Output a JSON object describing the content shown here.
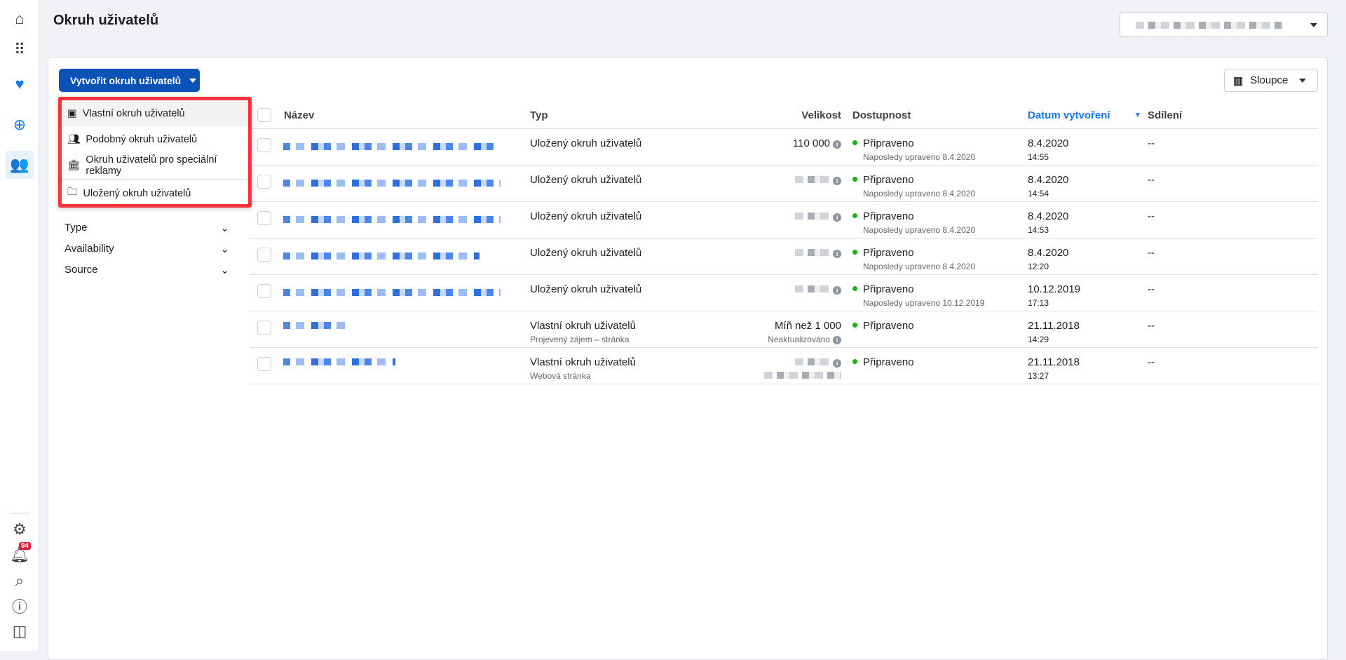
{
  "page": {
    "title": "Okruh uživatelů"
  },
  "nav": {
    "notifications_count": "94"
  },
  "toolbar": {
    "create_label": "Vytvořit okruh uživatelů",
    "columns_label": "Sloupce"
  },
  "create_menu": [
    {
      "label": "Vlastní okruh uživatelů",
      "icon": "custom-audience-icon"
    },
    {
      "label": "Podobný okruh uživatelů",
      "icon": "lookalike-icon"
    },
    {
      "label": "Okruh uživatelů pro speciální reklamy",
      "icon": "bank-icon"
    },
    {
      "label": "Uložený okruh uživatelů",
      "icon": "folder-icon"
    }
  ],
  "filters": [
    {
      "label": "Type"
    },
    {
      "label": "Availability"
    },
    {
      "label": "Source"
    }
  ],
  "table": {
    "headers": {
      "name": "Název",
      "type": "Typ",
      "size": "Velikost",
      "availability": "Dostupnost",
      "created": "Datum vytvoření",
      "sharing": "Sdílení"
    },
    "sort_color": "#1877f2",
    "rows": [
      {
        "type": "Uložený okruh uživatelů",
        "type_sub": "",
        "size": "110 000",
        "size_sub": "",
        "status": "Připraveno",
        "status_sub": "Naposledy upraveno 8.4.2020",
        "date": "8.4.2020",
        "time": "14:55",
        "sharing": "--"
      },
      {
        "type": "Uložený okruh uživatelů",
        "type_sub": "",
        "size": "",
        "size_sub": "",
        "status": "Připraveno",
        "status_sub": "Naposledy upraveno 8.4.2020",
        "date": "8.4.2020",
        "time": "14:54",
        "sharing": "--"
      },
      {
        "type": "Uložený okruh uživatelů",
        "type_sub": "",
        "size": "",
        "size_sub": "",
        "status": "Připraveno",
        "status_sub": "Naposledy upraveno 8.4.2020",
        "date": "8.4.2020",
        "time": "14:53",
        "sharing": "--"
      },
      {
        "type": "Uložený okruh uživatelů",
        "type_sub": "",
        "size": "",
        "size_sub": "",
        "status": "Připraveno",
        "status_sub": "Naposledy upraveno 8.4.2020",
        "date": "8.4.2020",
        "time": "12:20",
        "sharing": "--"
      },
      {
        "type": "Uložený okruh uživatelů",
        "type_sub": "",
        "size": "",
        "size_sub": "",
        "status": "Připraveno",
        "status_sub": "Naposledy upraveno 10.12.2019",
        "date": "10.12.2019",
        "time": "17:13",
        "sharing": "--"
      },
      {
        "type": "Vlastní okruh uživatelů",
        "type_sub": "Projevený zájem – stránka",
        "size": "Míň než 1 000",
        "size_sub": "Neaktualizováno",
        "status": "Připraveno",
        "status_sub": "",
        "date": "21.11.2018",
        "time": "14:29",
        "sharing": "--"
      },
      {
        "type": "Vlastní okruh uživatelů",
        "type_sub": "Webová stránka",
        "size": "",
        "size_sub": "",
        "status": "Připraveno",
        "status_sub": "",
        "date": "21.11.2018",
        "time": "13:27",
        "sharing": "--"
      }
    ]
  }
}
